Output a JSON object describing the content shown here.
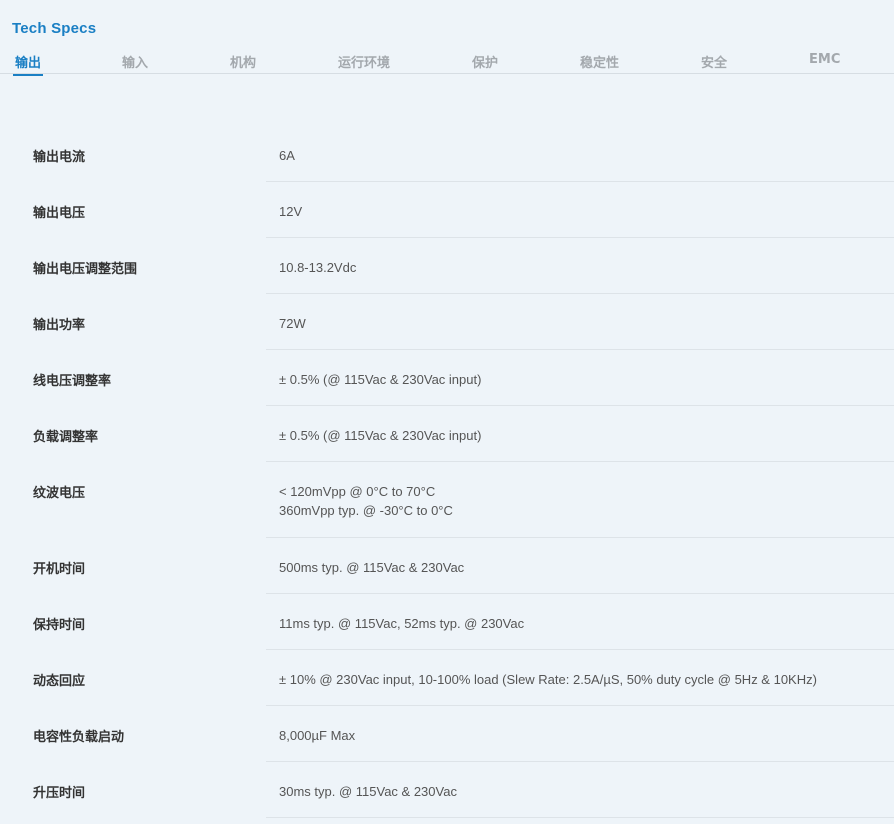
{
  "title": "Tech Specs",
  "tabs": [
    {
      "label": "输出",
      "active": true
    },
    {
      "label": "输入",
      "active": false
    },
    {
      "label": "机构",
      "active": false
    },
    {
      "label": "运行环境",
      "active": false
    },
    {
      "label": "保护",
      "active": false
    },
    {
      "label": "稳定性",
      "active": false
    },
    {
      "label": "安全",
      "active": false
    },
    {
      "label": "EMC",
      "active": false
    }
  ],
  "specs": [
    {
      "label": "输出电流",
      "value": "6A"
    },
    {
      "label": "输出电压",
      "value": "12V"
    },
    {
      "label": "输出电压调整范围",
      "value": "10.8-13.2Vdc"
    },
    {
      "label": "输出功率",
      "value": "72W"
    },
    {
      "label": "线电压调整率",
      "value": "± 0.5% (@ 115Vac & 230Vac input)"
    },
    {
      "label": "负载调整率",
      "value": "± 0.5% (@ 115Vac & 230Vac input)"
    },
    {
      "label": "纹波电压",
      "value": "< 120mVpp @ 0°C to 70°C",
      "value2": "360mVpp typ. @ -30°C to 0°C"
    },
    {
      "label": "开机时间",
      "value": "500ms typ. @ 115Vac & 230Vac"
    },
    {
      "label": "保持时间",
      "value": "11ms typ. @ 115Vac, 52ms typ. @ 230Vac"
    },
    {
      "label": "动态回应",
      "value": "± 10% @ 230Vac input, 10-100% load (Slew Rate: 2.5A/µS, 50% duty cycle @ 5Hz & 10KHz)"
    },
    {
      "label": "电容性负载启动",
      "value": "8,000µF Max"
    },
    {
      "label": "升压时间",
      "value": "30ms typ. @ 115Vac & 230Vac"
    }
  ]
}
